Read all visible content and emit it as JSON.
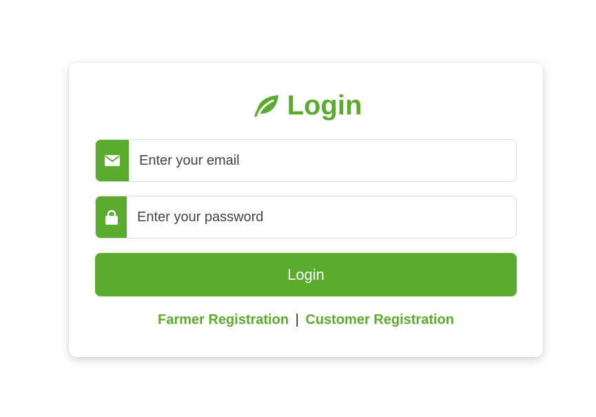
{
  "login": {
    "title": "Login",
    "title_icon": "leaf-icon",
    "email": {
      "icon": "envelope-icon",
      "placeholder": "Enter your email"
    },
    "password": {
      "icon": "lock-icon",
      "placeholder": "Enter your password"
    },
    "submit_label": "Login",
    "links": {
      "farmer": "Farmer Registration",
      "separator": "|",
      "customer": "Customer Registration"
    }
  },
  "colors": {
    "accent": "#5aab2e",
    "border": "#dcdcdc",
    "background": "#ffffff"
  }
}
